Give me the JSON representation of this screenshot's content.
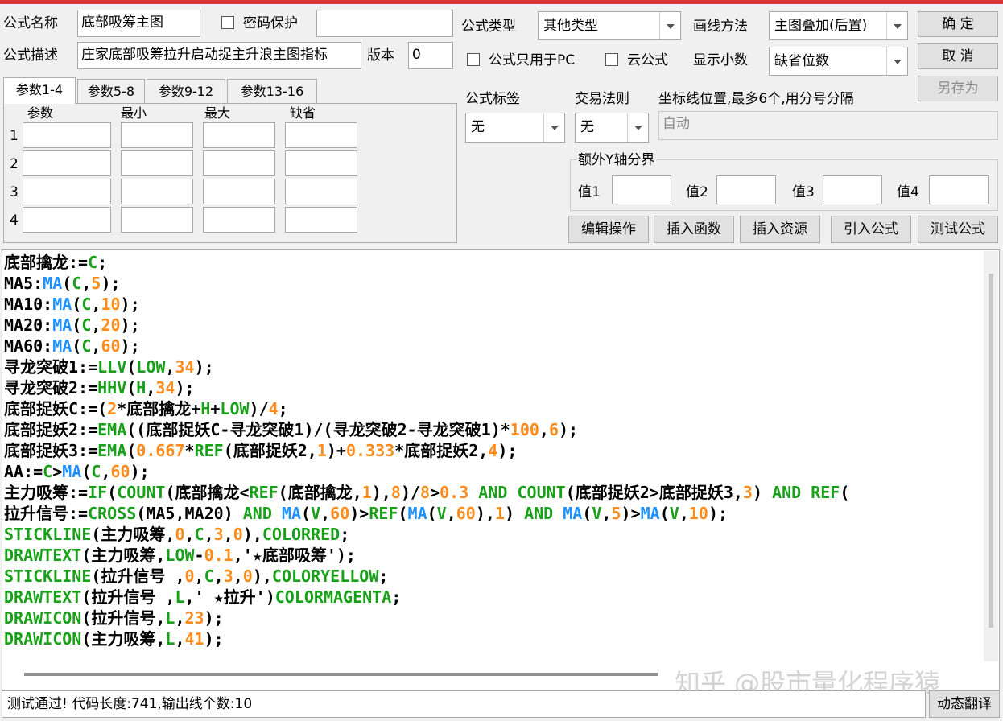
{
  "form": {
    "name_label": "公式名称",
    "name_value": "底部吸筹主图",
    "password_label": "密码保护",
    "password_value": "",
    "desc_label": "公式描述",
    "desc_value": "庄家底部吸筹拉升启动捉主升浪主图指标",
    "version_label": "版本",
    "version_value": "0",
    "type_label": "公式类型",
    "type_value": "其他类型",
    "draw_label": "画线方法",
    "draw_value": "主图叠加(后置)",
    "pc_only_label": "公式只用于PC",
    "cloud_label": "云公式",
    "decimals_label": "显示小数",
    "decimals_value": "缺省位数",
    "tag_label": "公式标签",
    "tag_value": "无",
    "rule_label": "交易法则",
    "rule_value": "无",
    "axis_label": "坐标线位置,最多6个,用分号分隔",
    "axis_value": "自动",
    "extra_y_label": "额外Y轴分界",
    "val1_label": "值1",
    "val2_label": "值2",
    "val3_label": "值3",
    "val4_label": "值4"
  },
  "buttons": {
    "ok": "确  定",
    "cancel": "取  消",
    "save_as": "另存为",
    "edit_ops": "编辑操作",
    "insert_func": "插入函数",
    "insert_res": "插入资源",
    "import_formula": "引入公式",
    "test_formula": "测试公式",
    "translate": "动态翻译"
  },
  "params": {
    "tabs": [
      "参数1-4",
      "参数5-8",
      "参数9-12",
      "参数13-16"
    ],
    "headers": [
      "参数",
      "最小",
      "最大",
      "缺省"
    ],
    "rows": [
      "1",
      "2",
      "3",
      "4"
    ]
  },
  "code": {
    "lines": [
      [
        [
          "底部擒龙:=",
          "#000000"
        ],
        [
          "C",
          "#19a019"
        ],
        [
          ";",
          "#000000"
        ]
      ],
      [
        [
          "MA5:",
          "#000000"
        ],
        [
          "MA",
          "#1e90ff"
        ],
        [
          "(",
          "#000000"
        ],
        [
          "C",
          "#19a019"
        ],
        [
          ",",
          "#000000"
        ],
        [
          "5",
          "#ff8c1a"
        ],
        [
          ");",
          "#000000"
        ]
      ],
      [
        [
          "MA10:",
          "#000000"
        ],
        [
          "MA",
          "#1e90ff"
        ],
        [
          "(",
          "#000000"
        ],
        [
          "C",
          "#19a019"
        ],
        [
          ",",
          "#000000"
        ],
        [
          "10",
          "#ff8c1a"
        ],
        [
          ");",
          "#000000"
        ]
      ],
      [
        [
          "MA20:",
          "#000000"
        ],
        [
          "MA",
          "#1e90ff"
        ],
        [
          "(",
          "#000000"
        ],
        [
          "C",
          "#19a019"
        ],
        [
          ",",
          "#000000"
        ],
        [
          "20",
          "#ff8c1a"
        ],
        [
          ");",
          "#000000"
        ]
      ],
      [
        [
          "MA60:",
          "#000000"
        ],
        [
          "MA",
          "#1e90ff"
        ],
        [
          "(",
          "#000000"
        ],
        [
          "C",
          "#19a019"
        ],
        [
          ",",
          "#000000"
        ],
        [
          "60",
          "#ff8c1a"
        ],
        [
          ");",
          "#000000"
        ]
      ],
      [
        [
          "寻龙突破1:=",
          "#000000"
        ],
        [
          "LLV",
          "#19a019"
        ],
        [
          "(",
          "#000000"
        ],
        [
          "LOW",
          "#19a019"
        ],
        [
          ",",
          "#000000"
        ],
        [
          "34",
          "#ff8c1a"
        ],
        [
          ");",
          "#000000"
        ]
      ],
      [
        [
          "寻龙突破2:=",
          "#000000"
        ],
        [
          "HHV",
          "#19a019"
        ],
        [
          "(",
          "#000000"
        ],
        [
          "H",
          "#19a019"
        ],
        [
          ",",
          "#000000"
        ],
        [
          "34",
          "#ff8c1a"
        ],
        [
          ");",
          "#000000"
        ]
      ],
      [
        [
          "底部捉妖C:=(",
          "#000000"
        ],
        [
          "2",
          "#ff8c1a"
        ],
        [
          "*底部擒龙+",
          "#000000"
        ],
        [
          "H",
          "#19a019"
        ],
        [
          "+",
          "#000000"
        ],
        [
          "LOW",
          "#19a019"
        ],
        [
          ")/",
          "#000000"
        ],
        [
          "4",
          "#ff8c1a"
        ],
        [
          ";",
          "#000000"
        ]
      ],
      [
        [
          "底部捉妖2:=",
          "#000000"
        ],
        [
          "EMA",
          "#19a019"
        ],
        [
          "((底部捉妖C-寻龙突破1)/(寻龙突破2-寻龙突破1)*",
          "#000000"
        ],
        [
          "100",
          "#ff8c1a"
        ],
        [
          ",",
          "#000000"
        ],
        [
          "6",
          "#ff8c1a"
        ],
        [
          ");",
          "#000000"
        ]
      ],
      [
        [
          "底部捉妖3:=",
          "#000000"
        ],
        [
          "EMA",
          "#19a019"
        ],
        [
          "(",
          "#000000"
        ],
        [
          "0.667",
          "#ff8c1a"
        ],
        [
          "*",
          "#000000"
        ],
        [
          "REF",
          "#19a019"
        ],
        [
          "(底部捉妖2,",
          "#000000"
        ],
        [
          "1",
          "#ff8c1a"
        ],
        [
          ")+",
          "#000000"
        ],
        [
          "0.333",
          "#ff8c1a"
        ],
        [
          "*底部捉妖2,",
          "#000000"
        ],
        [
          "4",
          "#ff8c1a"
        ],
        [
          ");",
          "#000000"
        ]
      ],
      [
        [
          "AA:=",
          "#000000"
        ],
        [
          "C",
          "#19a019"
        ],
        [
          ">",
          "#000000"
        ],
        [
          "MA",
          "#1e90ff"
        ],
        [
          "(",
          "#000000"
        ],
        [
          "C",
          "#19a019"
        ],
        [
          ",",
          "#000000"
        ],
        [
          "60",
          "#ff8c1a"
        ],
        [
          ");",
          "#000000"
        ]
      ],
      [
        [
          "主力吸筹:=",
          "#000000"
        ],
        [
          "IF",
          "#19a019"
        ],
        [
          "(",
          "#000000"
        ],
        [
          "COUNT",
          "#19a019"
        ],
        [
          "(底部擒龙<",
          "#000000"
        ],
        [
          "REF",
          "#19a019"
        ],
        [
          "(底部擒龙,",
          "#000000"
        ],
        [
          "1",
          "#ff8c1a"
        ],
        [
          "),",
          "#000000"
        ],
        [
          "8",
          "#ff8c1a"
        ],
        [
          ")/",
          "#000000"
        ],
        [
          "8",
          "#ff8c1a"
        ],
        [
          ">",
          "#000000"
        ],
        [
          "0.3",
          "#ff8c1a"
        ],
        [
          " AND ",
          "#19a019"
        ],
        [
          "COUNT",
          "#19a019"
        ],
        [
          "(底部捉妖2>底部捉妖3,",
          "#000000"
        ],
        [
          "3",
          "#ff8c1a"
        ],
        [
          ") ",
          "#000000"
        ],
        [
          "AND REF",
          "#19a019"
        ],
        [
          "(",
          "#000000"
        ]
      ],
      [
        [
          "拉升信号:=",
          "#000000"
        ],
        [
          "CROSS",
          "#19a019"
        ],
        [
          "(MA5,MA20) ",
          "#000000"
        ],
        [
          "AND ",
          "#19a019"
        ],
        [
          "MA",
          "#1e90ff"
        ],
        [
          "(",
          "#000000"
        ],
        [
          "V",
          "#19a019"
        ],
        [
          ",",
          "#000000"
        ],
        [
          "60",
          "#ff8c1a"
        ],
        [
          ")>",
          "#000000"
        ],
        [
          "REF",
          "#19a019"
        ],
        [
          "(",
          "#000000"
        ],
        [
          "MA",
          "#1e90ff"
        ],
        [
          "(",
          "#000000"
        ],
        [
          "V",
          "#19a019"
        ],
        [
          ",",
          "#000000"
        ],
        [
          "60",
          "#ff8c1a"
        ],
        [
          "),",
          "#000000"
        ],
        [
          "1",
          "#ff8c1a"
        ],
        [
          ") ",
          "#000000"
        ],
        [
          "AND ",
          "#19a019"
        ],
        [
          "MA",
          "#1e90ff"
        ],
        [
          "(",
          "#000000"
        ],
        [
          "V",
          "#19a019"
        ],
        [
          ",",
          "#000000"
        ],
        [
          "5",
          "#ff8c1a"
        ],
        [
          ")>",
          "#000000"
        ],
        [
          "MA",
          "#1e90ff"
        ],
        [
          "(",
          "#000000"
        ],
        [
          "V",
          "#19a019"
        ],
        [
          ",",
          "#000000"
        ],
        [
          "10",
          "#ff8c1a"
        ],
        [
          ");",
          "#000000"
        ]
      ],
      [
        [
          "STICKLINE",
          "#19a019"
        ],
        [
          "(主力吸筹,",
          "#000000"
        ],
        [
          "0",
          "#ff8c1a"
        ],
        [
          ",",
          "#000000"
        ],
        [
          "C",
          "#19a019"
        ],
        [
          ",",
          "#000000"
        ],
        [
          "3",
          "#ff8c1a"
        ],
        [
          ",",
          "#000000"
        ],
        [
          "0",
          "#ff8c1a"
        ],
        [
          "),",
          "#000000"
        ],
        [
          "COLORRED",
          "#19a019"
        ],
        [
          ";",
          "#000000"
        ]
      ],
      [
        [
          "DRAWTEXT",
          "#19a019"
        ],
        [
          "(主力吸筹,",
          "#000000"
        ],
        [
          "LOW",
          "#19a019"
        ],
        [
          "-",
          "#000000"
        ],
        [
          "0.1",
          "#ff8c1a"
        ],
        [
          ",'★底部吸筹');",
          "#000000"
        ]
      ],
      [
        [
          "STICKLINE",
          "#19a019"
        ],
        [
          "(拉升信号 ,",
          "#000000"
        ],
        [
          "0",
          "#ff8c1a"
        ],
        [
          ",",
          "#000000"
        ],
        [
          "C",
          "#19a019"
        ],
        [
          ",",
          "#000000"
        ],
        [
          "3",
          "#ff8c1a"
        ],
        [
          ",",
          "#000000"
        ],
        [
          "0",
          "#ff8c1a"
        ],
        [
          "),",
          "#000000"
        ],
        [
          "COLORYELLOW",
          "#19a019"
        ],
        [
          ";",
          "#000000"
        ]
      ],
      [
        [
          "DRAWTEXT",
          "#19a019"
        ],
        [
          "(拉升信号 ,",
          "#000000"
        ],
        [
          "L",
          "#19a019"
        ],
        [
          ",' ★拉升')",
          "#000000"
        ],
        [
          "COLORMAGENTA",
          "#19a019"
        ],
        [
          ";",
          "#000000"
        ]
      ],
      [
        [
          "DRAWICON",
          "#19a019"
        ],
        [
          "(拉升信号,",
          "#000000"
        ],
        [
          "L",
          "#19a019"
        ],
        [
          ",",
          "#000000"
        ],
        [
          "23",
          "#ff8c1a"
        ],
        [
          ");",
          "#000000"
        ]
      ],
      [
        [
          "DRAWICON",
          "#19a019"
        ],
        [
          "(主力吸筹,",
          "#000000"
        ],
        [
          "L",
          "#19a019"
        ],
        [
          ",",
          "#000000"
        ],
        [
          "41",
          "#ff8c1a"
        ],
        [
          ");",
          "#000000"
        ]
      ]
    ]
  },
  "status": "测试通过! 代码长度:741,输出线个数:10",
  "watermark": "知乎 @股市量化程序猿",
  "colors": {
    "accent_bar": "#d9363e",
    "keyword": "#19a019",
    "function_ma": "#1e90ff",
    "number": "#ff8c1a"
  }
}
